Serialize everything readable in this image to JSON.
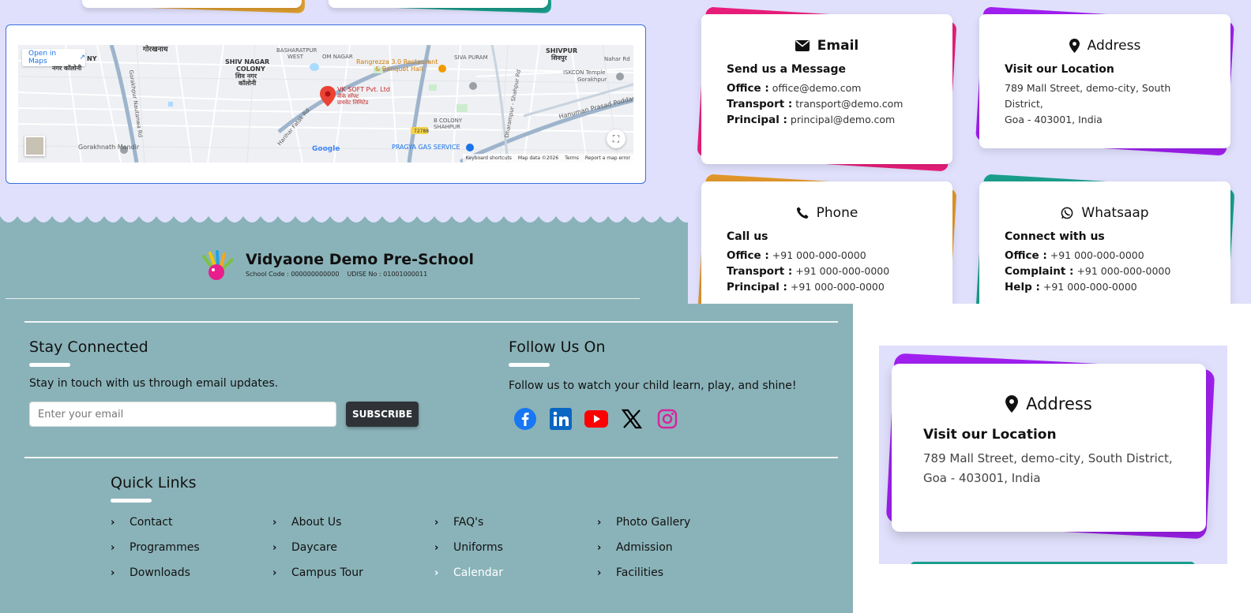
{
  "map": {
    "open_in_maps": "Open in Maps",
    "labels": {
      "gorakhnath": "गोरखनाथ",
      "shivnagar_en": "SHIV NAGAR",
      "shivnagar_en2": "COLONY",
      "shivnagar_hi": "शिव नगर",
      "shivnagar_hi2": "कॉलोनी",
      "basharatpur": "BASHARATPUR",
      "basharatpur2": "WEST",
      "om_nagar": "OM NAGAR",
      "rangrezza": "Rangrezza 3.0 Restaurant",
      "rangrezza2": "& Banquet Hall",
      "siva_puram": "SIVA PURAM",
      "shivpur": "SHIVPUR",
      "shivpur_hi": "शिवपुर",
      "nahar_rd": "Nahar Rd",
      "iskcon": "ISKCON Temple",
      "iskcon2": "Gorakhpur",
      "vk_soft": "VK SOFT Pvt. Ltd",
      "vk_soft_hi": "वीके सॉफ्ट",
      "vk_soft_hi2": "प्रायवेट लिमिटेड",
      "hanuman": "Hanuman Prasad Poddar Marg",
      "b_colony": "B COLONY",
      "b_colony2": "SHAHPUR",
      "dharampur": "Dharampur - Shahpur Rd",
      "harihar": "Harihar Fatak Rd",
      "gorakhnath_mandir": "Gorakhnath Mandir",
      "pragya": "PRAGYA GAS SERVICE",
      "road_no": "72788",
      "nagar_colony": "नगर कॉलोनी",
      "ny": "NY",
      "gorakhpur_rd": "Gorakhpur Nautanwa Rd"
    },
    "google": "Google",
    "footer": {
      "shortcuts": "Keyboard shortcuts",
      "data": "Map data ©2026",
      "terms": "Terms",
      "report": "Report a map error"
    }
  },
  "school": {
    "name": "Vidyaone Demo Pre-School",
    "school_code": "School Code : 000000000000",
    "udise": "UDISE No : 01001000011"
  },
  "stay_connected": {
    "title": "Stay Connected",
    "text": "Stay in touch with us through email updates.",
    "placeholder": "Enter your email",
    "button": "SUBSCRIBE"
  },
  "follow": {
    "title": "Follow Us On",
    "text": "Follow us to watch your child learn, play, and shine!",
    "icons": [
      "facebook-icon",
      "linkedin-icon",
      "youtube-icon",
      "x-icon",
      "instagram-icon"
    ]
  },
  "quick_links": {
    "title": "Quick Links",
    "items": [
      "Contact",
      "About Us",
      "FAQ's",
      "Photo Gallery",
      "Programmes",
      "Daycare",
      "Uniforms",
      "Admission",
      "Downloads",
      "Campus Tour",
      "Calendar",
      "Facilities"
    ],
    "active": "Calendar"
  },
  "cards": {
    "email": {
      "title": "Email",
      "sub": "Send us a Message",
      "lines": [
        {
          "k": "Office :",
          "v": "office@demo.com"
        },
        {
          "k": "Transport :",
          "v": "transport@demo.com"
        },
        {
          "k": "Principal :",
          "v": "principal@demo.com"
        }
      ],
      "accent": "#e91e7a"
    },
    "address": {
      "title": "Address",
      "sub": "Visit our Location",
      "addr1": "789 Mall Street, demo-city, South District,",
      "addr2": "Goa - 403001, India",
      "accent": "#a020f0"
    },
    "phone": {
      "title": "Phone",
      "sub": "Call us",
      "lines": [
        {
          "k": "Office :",
          "v": "+91 000-000-0000"
        },
        {
          "k": "Transport :",
          "v": "+91 000-000-0000"
        },
        {
          "k": "Principal :",
          "v": "+91 000-000-0000"
        }
      ],
      "accent": "#e0962a"
    },
    "whatsapp": {
      "title": "Whatsaap",
      "sub": "Connect with us",
      "lines": [
        {
          "k": "Office :",
          "v": "+91 000-000-0000"
        },
        {
          "k": "Complaint :",
          "v": "+91 000-000-0000"
        },
        {
          "k": "Help :",
          "v": "+91 000-000-0000"
        }
      ],
      "accent": "#1a9e8c"
    }
  },
  "colors": {
    "footer_bg": "#8ab3b9",
    "page_lavender": "#e0e0fc",
    "subscribe_bg": "#2f3338"
  }
}
